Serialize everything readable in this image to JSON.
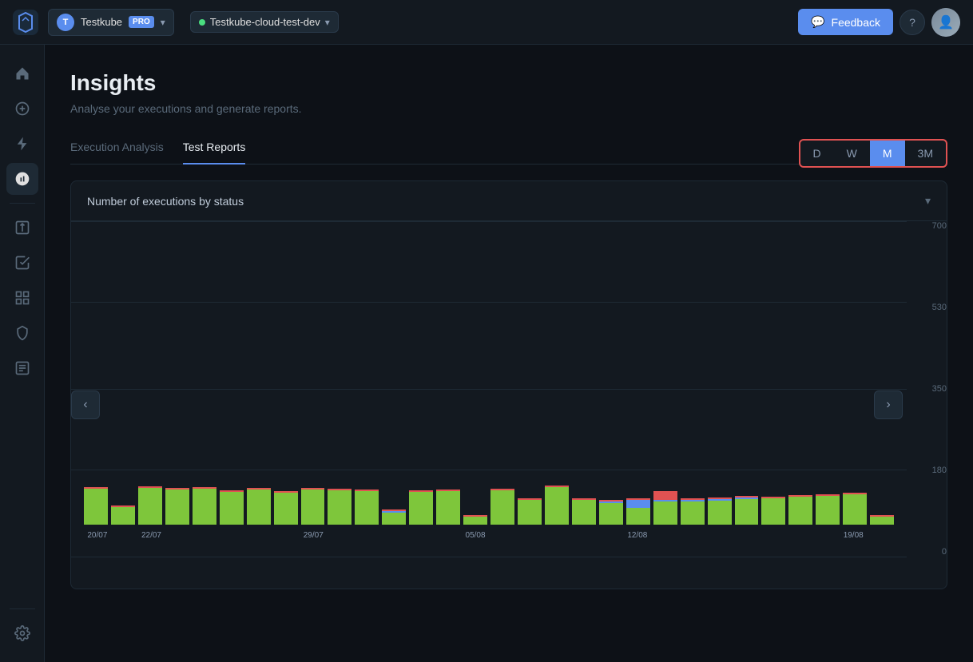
{
  "app": {
    "logo_letter": "K",
    "workspace": {
      "avatar_letter": "T",
      "name": "Testkube",
      "badge": "PRO"
    },
    "env": {
      "name": "Testkube-cloud-test-dev",
      "status": "active"
    },
    "feedback_label": "Feedback",
    "help_label": "?",
    "user_initials": "U"
  },
  "sidebar": {
    "items": [
      {
        "id": "home",
        "icon": "home-icon",
        "active": false
      },
      {
        "id": "add",
        "icon": "add-icon",
        "active": false
      },
      {
        "id": "lightning",
        "icon": "lightning-icon",
        "active": false
      },
      {
        "id": "insights",
        "icon": "insights-icon",
        "active": true
      },
      {
        "id": "test-suites",
        "icon": "test-suites-icon",
        "active": false
      },
      {
        "id": "reports",
        "icon": "reports-icon",
        "active": false
      },
      {
        "id": "security",
        "icon": "security-icon",
        "active": false
      },
      {
        "id": "logs",
        "icon": "logs-icon",
        "active": false
      }
    ]
  },
  "page": {
    "title": "Insights",
    "subtitle": "Analyse your executions and generate reports.",
    "tabs": [
      {
        "id": "execution-analysis",
        "label": "Execution Analysis",
        "active": false
      },
      {
        "id": "test-reports",
        "label": "Test Reports",
        "active": true
      }
    ]
  },
  "time_filters": [
    {
      "id": "D",
      "label": "D",
      "active": false
    },
    {
      "id": "W",
      "label": "W",
      "active": false
    },
    {
      "id": "M",
      "label": "M",
      "active": true
    },
    {
      "id": "3M",
      "label": "3M",
      "active": false
    }
  ],
  "chart": {
    "title": "Number of executions by status",
    "y_labels": [
      "700",
      "530",
      "350",
      "180",
      "0"
    ],
    "x_labels": [
      {
        "date": "20/07",
        "visible": true
      },
      {
        "date": "22/07",
        "visible": true
      },
      {
        "date": "",
        "visible": false
      },
      {
        "date": "29/07",
        "visible": true
      },
      {
        "date": "",
        "visible": false
      },
      {
        "date": "",
        "visible": false
      },
      {
        "date": "05/08",
        "visible": true
      },
      {
        "date": "",
        "visible": false
      },
      {
        "date": "12/08",
        "visible": true
      },
      {
        "date": "",
        "visible": false
      },
      {
        "date": "19/08",
        "visible": true
      }
    ],
    "bars": [
      {
        "green": 88,
        "red": 3,
        "blue": 0
      },
      {
        "green": 42,
        "red": 3,
        "blue": 0
      },
      {
        "green": 90,
        "red": 3,
        "blue": 0
      },
      {
        "green": 85,
        "red": 3,
        "blue": 0
      },
      {
        "green": 87,
        "red": 3,
        "blue": 0
      },
      {
        "green": 80,
        "red": 3,
        "blue": 0
      },
      {
        "green": 85,
        "red": 3,
        "blue": 0
      },
      {
        "green": 78,
        "red": 3,
        "blue": 0
      },
      {
        "green": 86,
        "red": 3,
        "blue": 0
      },
      {
        "green": 84,
        "red": 3,
        "blue": 0
      },
      {
        "green": 82,
        "red": 3,
        "blue": 0
      },
      {
        "green": 30,
        "red": 2,
        "blue": 1
      },
      {
        "green": 79,
        "red": 3,
        "blue": 0
      },
      {
        "green": 81,
        "red": 3,
        "blue": 0
      },
      {
        "green": 20,
        "red": 2,
        "blue": 0
      },
      {
        "green": 84,
        "red": 3,
        "blue": 0
      },
      {
        "green": 60,
        "red": 3,
        "blue": 0
      },
      {
        "green": 91,
        "red": 2,
        "blue": 0
      },
      {
        "green": 60,
        "red": 3,
        "blue": 0
      },
      {
        "green": 52,
        "red": 2,
        "blue": 2
      },
      {
        "green": 40,
        "red": 2,
        "blue": 20
      },
      {
        "green": 56,
        "red": 20,
        "blue": 5
      },
      {
        "green": 56,
        "red": 3,
        "blue": 3
      },
      {
        "green": 58,
        "red": 3,
        "blue": 3
      },
      {
        "green": 62,
        "red": 3,
        "blue": 3
      },
      {
        "green": 65,
        "red": 3,
        "blue": 0
      },
      {
        "green": 68,
        "red": 3,
        "blue": 0
      },
      {
        "green": 70,
        "red": 3,
        "blue": 0
      },
      {
        "green": 73,
        "red": 3,
        "blue": 0
      },
      {
        "green": 20,
        "red": 3,
        "blue": 0
      }
    ]
  },
  "colors": {
    "accent": "#5a8dee",
    "active_tab_border": "#5a8dee",
    "green_bar": "#7ec63b",
    "red_bar": "#e05252",
    "blue_bar": "#5a8dee",
    "time_filter_border": "#e05252"
  }
}
